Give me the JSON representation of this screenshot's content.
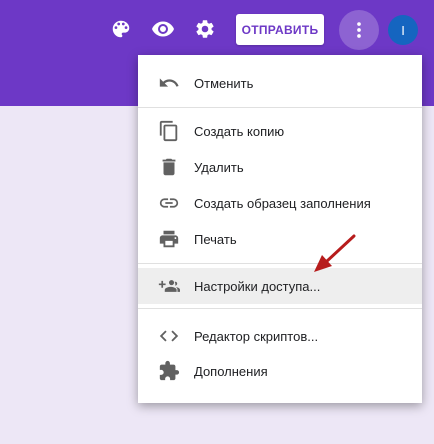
{
  "header": {
    "send_label": "ОТПРАВИТЬ",
    "avatar_letter": "I",
    "color": "#6d38c6",
    "icons": [
      "palette-icon",
      "eye-icon",
      "gear-icon",
      "more-vert-icon"
    ]
  },
  "menu": {
    "items": [
      {
        "label": "Отменить",
        "icon": "undo-icon"
      },
      {
        "label": "Создать копию",
        "icon": "copy-icon"
      },
      {
        "label": "Удалить",
        "icon": "trash-icon"
      },
      {
        "label": "Создать образец заполнения",
        "icon": "link-icon"
      },
      {
        "label": "Печать",
        "icon": "print-icon"
      },
      {
        "label": "Настройки доступа...",
        "icon": "add-people-icon",
        "highlighted": true
      },
      {
        "label": "Редактор скриптов...",
        "icon": "code-icon"
      },
      {
        "label": "Дополнения",
        "icon": "puzzle-icon"
      }
    ]
  },
  "annotation": {
    "arrow_color": "#b71c1c"
  }
}
